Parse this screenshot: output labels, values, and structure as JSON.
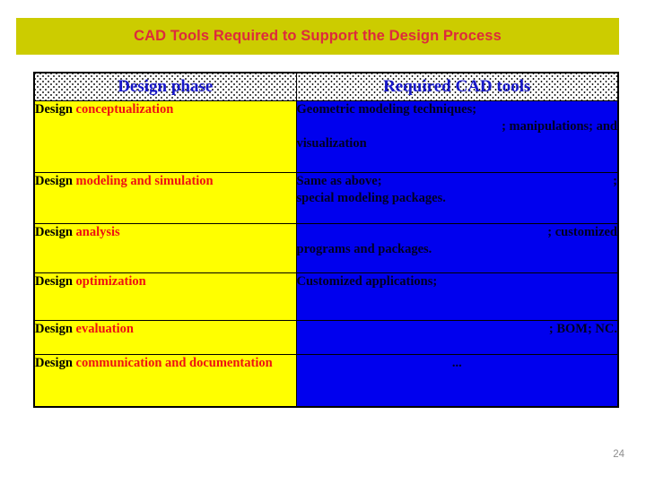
{
  "slide": {
    "title": "CAD Tools Required to Support the Design Process",
    "page_number": "24",
    "colors": {
      "title_banner_bg": "#cccc00",
      "title_text": "#dd2b3c",
      "phase_cell_bg": "#ffff00",
      "tools_cell_bg": "#0000ee",
      "header_text": "#1818c8",
      "keyword_text": "#ee1111",
      "page_number_text": "#8e8e8e"
    }
  },
  "table": {
    "headers": {
      "phase": "Design phase",
      "tools": "Required CAD tools"
    },
    "rows": [
      {
        "phase_prefix": "Design ",
        "phase_keyword": "conceptualization",
        "tools_lines": [
          {
            "visible": "Geometric modeling techniques;",
            "hidden": "",
            "align": "left"
          },
          {
            "visible": ";  manipulations; and",
            "hidden": "",
            "align": "left"
          },
          {
            "visible": "visualization",
            "hidden": "",
            "align": "left"
          }
        ]
      },
      {
        "phase_prefix": "Design ",
        "phase_keyword": "modeling and simulation",
        "tools_lines": [
          {
            "visible": "Same as above;",
            "hidden": "",
            "align": "left"
          },
          {
            "visible": ";",
            "hidden": "",
            "align": "right"
          },
          {
            "visible": "special modeling packages.",
            "hidden": "",
            "align": "left"
          }
        ]
      },
      {
        "phase_prefix": "Design ",
        "phase_keyword": "analysis",
        "tools_lines": [
          {
            "visible": "; customized",
            "hidden": "",
            "align": "right"
          },
          {
            "visible": "programs and packages.",
            "hidden": "",
            "align": "left"
          }
        ]
      },
      {
        "phase_prefix": "Design ",
        "phase_keyword": "optimization",
        "tools_lines": [
          {
            "visible": "Customized applications;",
            "hidden": "",
            "align": "left"
          }
        ]
      },
      {
        "phase_prefix": "Design ",
        "phase_keyword": "evaluation",
        "tools_lines": [
          {
            "visible": "; BOM; NC.",
            "hidden": "",
            "align": "right"
          }
        ]
      },
      {
        "phase_prefix": "Design ",
        "phase_keyword": "communication and documentation",
        "tools_lines": [
          {
            "visible": "...",
            "hidden": "",
            "align": "center"
          }
        ]
      }
    ]
  }
}
